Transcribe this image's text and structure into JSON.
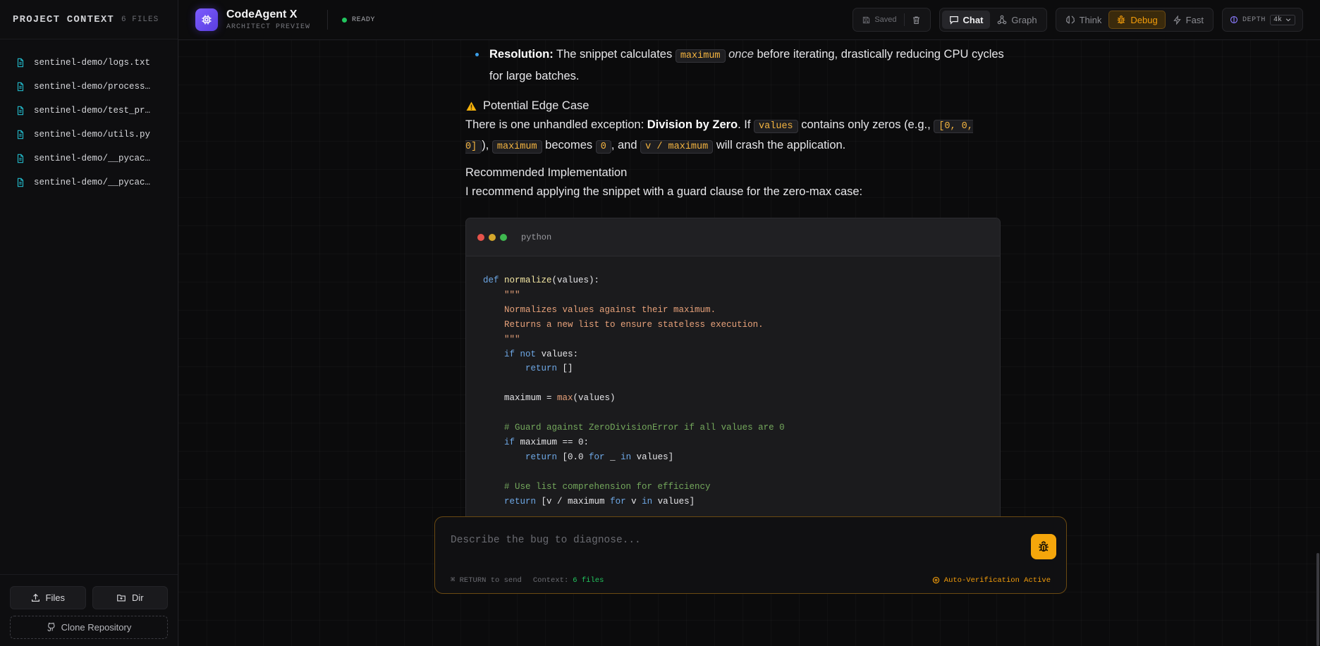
{
  "sidebar": {
    "title": "PROJECT CONTEXT",
    "count": "6 FILES",
    "files": [
      {
        "name": "sentinel-demo/logs.txt"
      },
      {
        "name": "sentinel-demo/processor.py"
      },
      {
        "name": "sentinel-demo/test_processor.py"
      },
      {
        "name": "sentinel-demo/utils.py"
      },
      {
        "name": "sentinel-demo/__pycache__/processor.cpython.pyc"
      },
      {
        "name": "sentinel-demo/__pycache__/utils.cpython.pyc"
      }
    ],
    "files_btn": "Files",
    "dir_btn": "Dir",
    "clone_btn": "Clone Repository"
  },
  "header": {
    "app_name": "CodeAgent X",
    "app_sub": "ARCHITECT PREVIEW",
    "status": "READY",
    "saved": "Saved",
    "view_chat": "Chat",
    "view_graph": "Graph",
    "mode_think": "Think",
    "mode_debug": "Debug",
    "mode_fast": "Fast",
    "depth_label": "DEPTH",
    "depth_value": "4k"
  },
  "message": {
    "resolution_label": "Resolution:",
    "resolution_t1": " The snippet calculates ",
    "resolution_code": "maximum",
    "resolution_em": "once",
    "resolution_t2": " before iterating, drastically reducing CPU cycles for large batches.",
    "edge_title": "Potential Edge Case",
    "edge_t1": "There is one unhandled exception: ",
    "edge_bold": "Division by Zero",
    "edge_t2": ". If ",
    "edge_code1": "values",
    "edge_t3": " contains only zeros (e.g., ",
    "edge_code2": "[0, 0, 0]",
    "edge_t4": "), ",
    "edge_code3": "maximum",
    "edge_t5": " becomes ",
    "edge_code4": "0",
    "edge_t6": ", and ",
    "edge_code5": "v / maximum",
    "edge_t7": " will crash the application.",
    "rec_title": "Recommended Implementation",
    "rec_text": "I recommend applying the snippet with a guard clause for the zero-max case:"
  },
  "code": {
    "language": "python",
    "colors": {
      "red": "#e5534b",
      "yellow": "#d4a72c",
      "green": "#3fb950"
    }
  },
  "input": {
    "placeholder": "Describe the bug to diagnose...",
    "hint": "⌘ RETURN to send",
    "context_label": "Context:",
    "context_value": "6 files",
    "auto_verification": "Auto-Verification Active"
  }
}
